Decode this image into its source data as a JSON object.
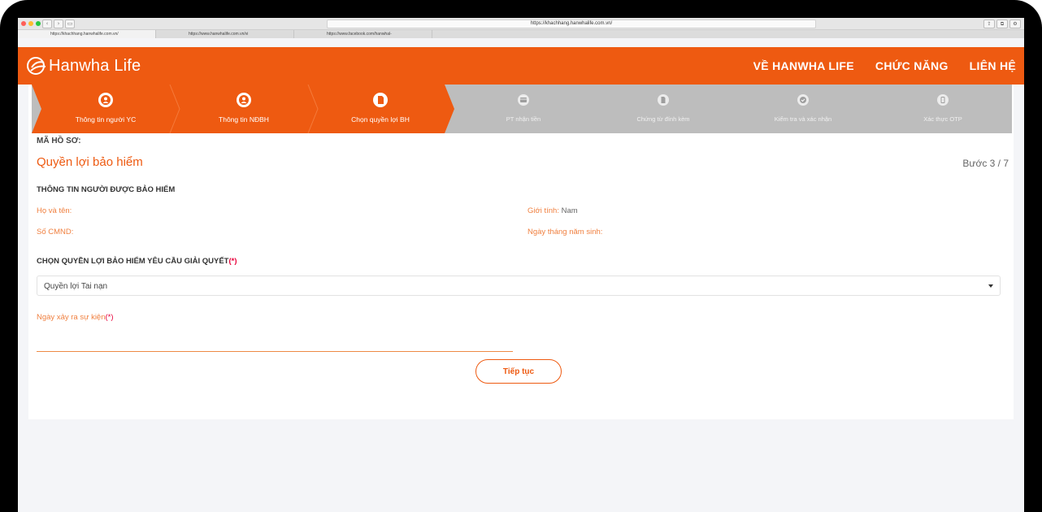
{
  "browser": {
    "url": "https://khachhang.hanwhalife.com.vn/",
    "tabs": [
      "https://khachhang.hanwhalife.com.vn/",
      "https://www.hanwhalife.com.vn/vi",
      "https://www.facebook.com/hanwhal-"
    ]
  },
  "header": {
    "logo_text": "Hanwha Life",
    "nav": [
      "VỀ HANWHA LIFE",
      "CHỨC NĂNG",
      "LIÊN HỆ"
    ],
    "brand_color": "#ee5a11"
  },
  "steps": [
    {
      "label": "Thông tin người YC",
      "icon": "user-icon",
      "state": "done"
    },
    {
      "label": "Thông tin NĐBH",
      "icon": "user-icon",
      "state": "done"
    },
    {
      "label": "Chọn quyền lợi BH",
      "icon": "document-icon",
      "state": "active"
    },
    {
      "label": "PT nhận tiền",
      "icon": "card-icon",
      "state": "inactive"
    },
    {
      "label": "Chứng từ đính kèm",
      "icon": "file-icon",
      "state": "inactive"
    },
    {
      "label": "Kiểm tra và xác nhận",
      "icon": "check-icon",
      "state": "inactive"
    },
    {
      "label": "Xác thực OTP",
      "icon": "phone-icon",
      "state": "inactive"
    }
  ],
  "form": {
    "ma_ho_so": "MÃ HỒ SƠ:",
    "title": "Quyền lợi bảo hiểm",
    "step_count": "Bước 3 / 7",
    "section_insured": "THÔNG TIN NGƯỜI ĐƯỢC BẢO HIỂM",
    "ho_va_ten_label": "Họ và tên:",
    "ho_va_ten_value": "",
    "gioi_tinh_label": "Giới tính:",
    "gioi_tinh_value": "Nam",
    "so_cmnd_label": "Số CMND:",
    "so_cmnd_value": "",
    "ngay_sinh_label": "Ngày tháng năm sinh:",
    "ngay_sinh_value": "",
    "section_benefit": "CHỌN QUYỀN LỢI BẢO HIỂM YÊU CẦU GIẢI QUYẾT",
    "required_mark": "(*)",
    "benefit_selected": "Quyền lợi Tai nạn",
    "event_date_label": "Ngày xảy ra sự kiện",
    "event_date_value": "",
    "continue_button": "Tiếp tục"
  }
}
